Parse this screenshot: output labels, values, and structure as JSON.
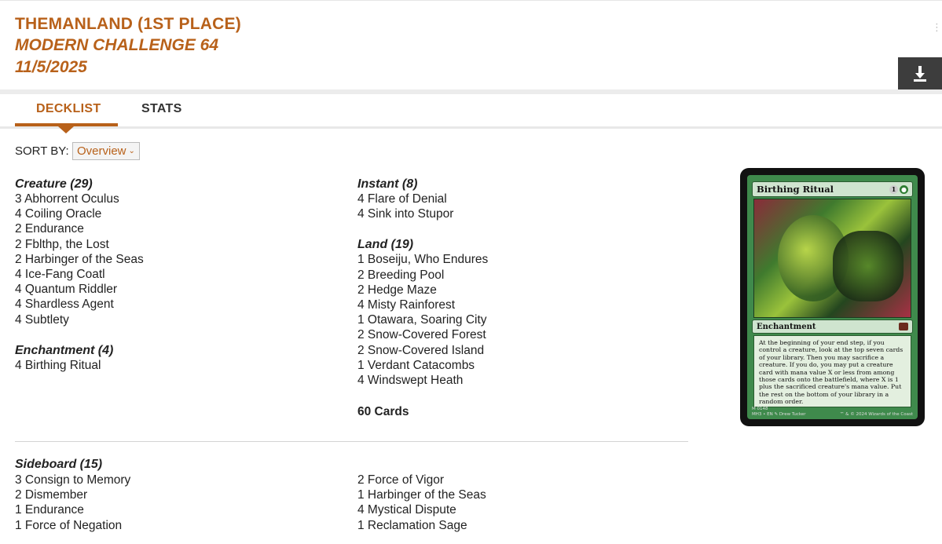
{
  "header": {
    "title": "THEMANLAND (1ST PLACE)",
    "event": "MODERN CHALLENGE 64",
    "date": "11/5/2025",
    "download_icon": "download-icon"
  },
  "tabs": [
    {
      "label": "DECKLIST",
      "active": true
    },
    {
      "label": "STATS",
      "active": false
    }
  ],
  "sort": {
    "label": "SORT BY:",
    "selected": "Overview"
  },
  "mainboard": {
    "left": [
      {
        "category": "Creature (29)",
        "cards": [
          "3 Abhorrent Oculus",
          "4 Coiling Oracle",
          "2 Endurance",
          "2 Fblthp, the Lost",
          "2 Harbinger of the Seas",
          "4 Ice-Fang Coatl",
          "4 Quantum Riddler",
          "4 Shardless Agent",
          "4 Subtlety"
        ]
      },
      {
        "category": "Enchantment (4)",
        "cards": [
          "4 Birthing Ritual"
        ]
      }
    ],
    "right": [
      {
        "category": "Instant (8)",
        "cards": [
          "4 Flare of Denial",
          "4 Sink into Stupor"
        ]
      },
      {
        "category": "Land (19)",
        "cards": [
          "1 Boseiju, Who Endures",
          "2 Breeding Pool",
          "2 Hedge Maze",
          "4 Misty Rainforest",
          "1 Otawara, Soaring City",
          "2 Snow-Covered Forest",
          "2 Snow-Covered Island",
          "1 Verdant Catacombs",
          "4 Windswept Heath"
        ]
      }
    ],
    "total": "60 Cards"
  },
  "sideboard": {
    "title": "Sideboard (15)",
    "left": [
      "3 Consign to Memory",
      "2 Dismember",
      "1 Endurance",
      "1 Force of Negation"
    ],
    "right": [
      "2 Force of Vigor",
      "1 Harbinger of the Seas",
      "4 Mystical Dispute",
      "1 Reclamation Sage"
    ]
  },
  "card_preview": {
    "name": "Birthing Ritual",
    "mana": [
      "1",
      "G"
    ],
    "type": "Enchantment",
    "rules_text": "At the beginning of your end step, if you control a creature, look at the top seven cards of your library. Then you may sacrifice a creature. If you do, you may put a creature card with mana value X or less from among those cards onto the battlefield, where X is 1 plus the sacrificed creature's mana value. Put the rest on the bottom of your library in a random order.",
    "footer_left": "M 0148\nMH3 • EN ✎ Drew Tucker",
    "footer_right": "™ & © 2024 Wizards of the Coast"
  }
}
